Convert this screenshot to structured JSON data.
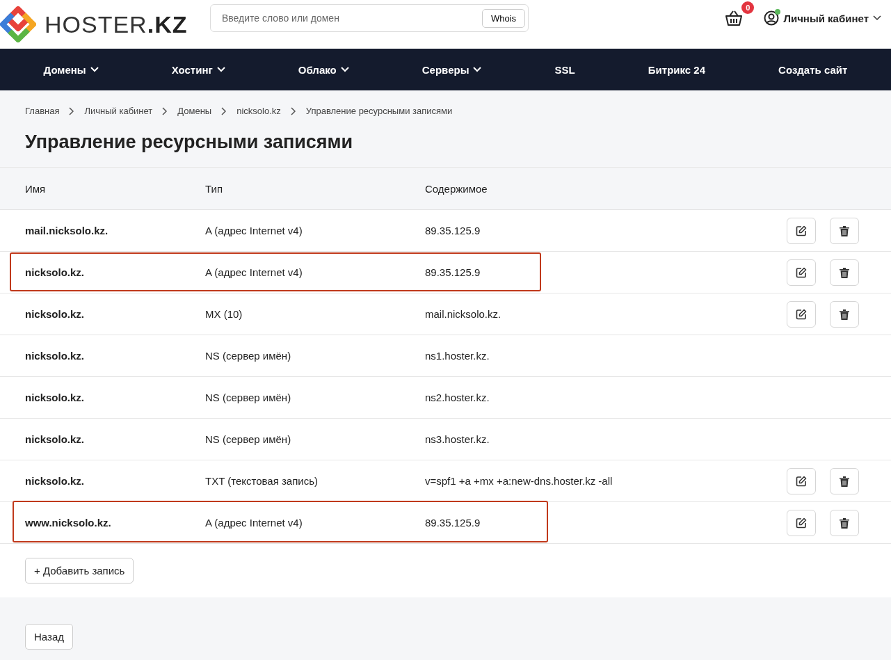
{
  "header": {
    "logo_text": "HOSTER",
    "logo_suffix": ".KZ",
    "search": {
      "placeholder": "Введите слово или домен",
      "button": "Whois"
    },
    "cart_count": "0",
    "account": {
      "label": "Личный кабинет",
      "online": true
    }
  },
  "nav": [
    {
      "label": "Домены",
      "dropdown": true
    },
    {
      "label": "Хостинг",
      "dropdown": true
    },
    {
      "label": "Облако",
      "dropdown": true
    },
    {
      "label": "Серверы",
      "dropdown": true
    },
    {
      "label": "SSL",
      "dropdown": false
    },
    {
      "label": "Битрикс 24",
      "dropdown": false
    },
    {
      "label": "Создать сайт",
      "dropdown": false
    }
  ],
  "breadcrumbs": [
    "Главная",
    "Личный кабинет",
    "Домены",
    "nicksolo.kz",
    "Управление ресурсными записями"
  ],
  "title": "Управление ресурсными записями",
  "table": {
    "columns": [
      "Имя",
      "Тип",
      "Содержимое"
    ],
    "rows": [
      {
        "name": "mail.nicksolo.kz.",
        "type": "A (адрес Internet v4)",
        "content": "89.35.125.9",
        "editable": true,
        "highlighted": false
      },
      {
        "name": "nicksolo.kz.",
        "type": "A (адрес Internet v4)",
        "content": "89.35.125.9",
        "editable": true,
        "highlighted": true
      },
      {
        "name": "nicksolo.kz.",
        "type": "MX (10)",
        "content": "mail.nicksolo.kz.",
        "editable": true,
        "highlighted": false
      },
      {
        "name": "nicksolo.kz.",
        "type": "NS (сервер имён)",
        "content": "ns1.hoster.kz.",
        "editable": false,
        "highlighted": false
      },
      {
        "name": "nicksolo.kz.",
        "type": "NS (сервер имён)",
        "content": "ns2.hoster.kz.",
        "editable": false,
        "highlighted": false
      },
      {
        "name": "nicksolo.kz.",
        "type": "NS (сервер имён)",
        "content": "ns3.hoster.kz.",
        "editable": false,
        "highlighted": false
      },
      {
        "name": "nicksolo.kz.",
        "type": "TXT (текстовая запись)",
        "content": "v=spf1 +a +mx +a:new-dns.hoster.kz -all",
        "editable": true,
        "highlighted": false
      },
      {
        "name": "www.nicksolo.kz.",
        "type": "A (адрес Internet v4)",
        "content": "89.35.125.9",
        "editable": true,
        "highlighted": true
      }
    ]
  },
  "add_button": "+ Добавить запись",
  "back_button": "Назад"
}
